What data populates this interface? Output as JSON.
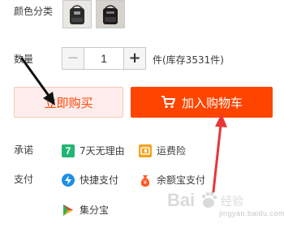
{
  "color": {
    "label": "颜色分类",
    "swatches": [
      "black-bag-variant",
      "dark-grey-bag-variant"
    ]
  },
  "quantity": {
    "label": "数量",
    "minus": "−",
    "value": "1",
    "plus": "+",
    "stock_text": "件(库存3531件)"
  },
  "buttons": {
    "buy_now": "立即购买",
    "add_cart": "加入购物车"
  },
  "promise": {
    "label": "承诺",
    "items": [
      {
        "icon": "seven-day-return-icon",
        "text": "7天无理由",
        "icon_text": "7"
      },
      {
        "icon": "shipping-insurance-icon",
        "text": "运费险"
      }
    ]
  },
  "payment": {
    "label": "支付",
    "items": [
      {
        "icon": "quick-pay-icon",
        "text": "快捷支付"
      },
      {
        "icon": "yuebao-icon",
        "text": "余额宝支付"
      },
      {
        "icon": "jifenbao-icon",
        "text": "集分宝"
      }
    ]
  },
  "watermark": {
    "text": "Bai",
    "sub": "jingyan.baidu.com"
  },
  "colors": {
    "accent": "#ff4400",
    "buy_now_bg": "#ffeded",
    "arrow_black": "#111111",
    "arrow_red": "#e8353a"
  }
}
